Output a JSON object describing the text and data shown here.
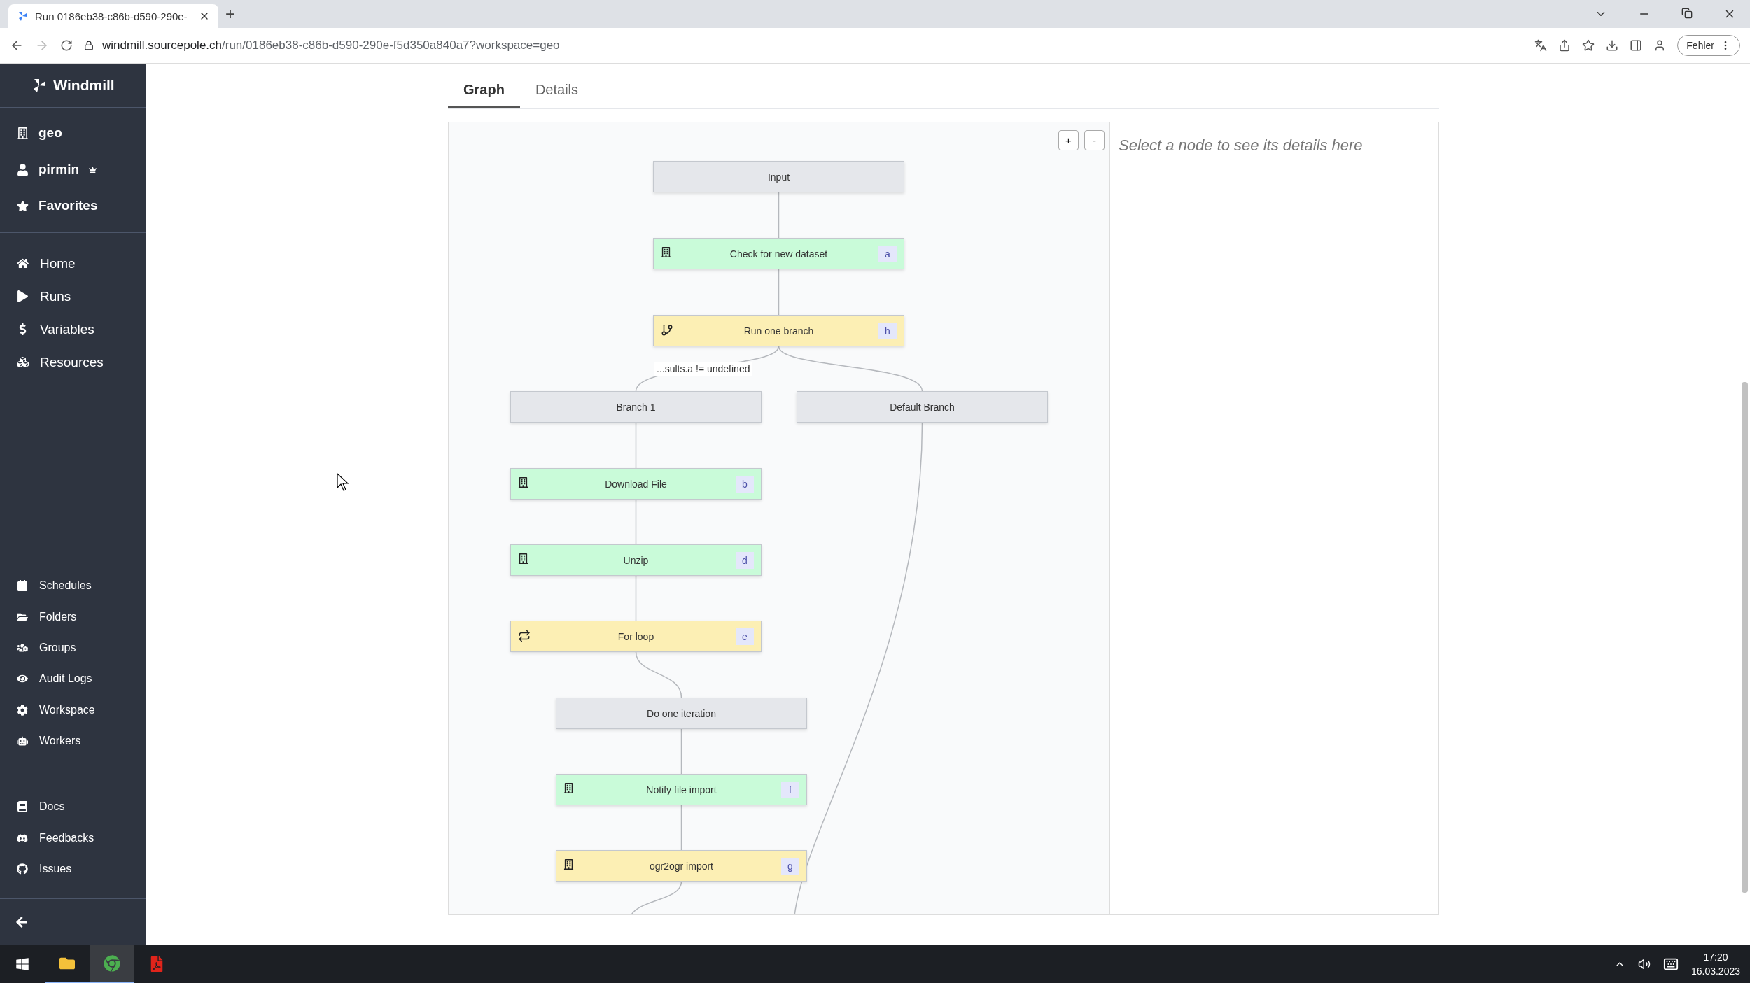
{
  "browser": {
    "tab_title": "Run 0186eb38-c86b-d590-290e-",
    "new_tab": "+",
    "url_host": "windmill.sourcepole.ch",
    "url_path": "/run/0186eb38-c86b-d590-290e-f5d350a840a7?workspace=geo",
    "profile_button": "Fehler"
  },
  "sidebar": {
    "brand": "Windmill",
    "workspace_menu": [
      {
        "label": "geo",
        "crown": false
      },
      {
        "label": "pirmin",
        "crown": true
      },
      {
        "label": "Favorites",
        "crown": false
      }
    ],
    "main_nav": [
      "Home",
      "Runs",
      "Variables",
      "Resources"
    ],
    "manage_nav": [
      "Schedules",
      "Folders",
      "Groups",
      "Audit Logs",
      "Workspace",
      "Workers"
    ],
    "help_nav": [
      "Docs",
      "Feedbacks",
      "Issues"
    ]
  },
  "tabs": [
    {
      "label": "Graph",
      "selected": true
    },
    {
      "label": "Details",
      "selected": false
    }
  ],
  "graph": {
    "zoom_in": "+",
    "zoom_out": "-",
    "edge_label": "...sults.a != undefined",
    "nodes": [
      {
        "label": "Input",
        "kind": "input",
        "color": "#e5e7eb"
      },
      {
        "label": "Check for new dataset",
        "kind": "script",
        "color": "#c9fbd9",
        "badge": "a"
      },
      {
        "label": "Run one branch",
        "kind": "branch",
        "color": "#fcefb4",
        "badge": "h"
      },
      {
        "label": "Branch 1",
        "kind": "group",
        "color": "#e5e7eb"
      },
      {
        "label": "Default Branch",
        "kind": "group",
        "color": "#e5e7eb"
      },
      {
        "label": "Download File",
        "kind": "script",
        "color": "#c9fbd9",
        "badge": "b"
      },
      {
        "label": "Unzip",
        "kind": "script",
        "color": "#c9fbd9",
        "badge": "d"
      },
      {
        "label": "For loop",
        "kind": "loop",
        "color": "#fcefb4",
        "badge": "e"
      },
      {
        "label": "Do one iteration",
        "kind": "group",
        "color": "#e5e7eb"
      },
      {
        "label": "Notify file import",
        "kind": "script",
        "color": "#c9fbd9",
        "badge": "f"
      },
      {
        "label": "ogr2ogr import",
        "kind": "script",
        "color": "#fcefb4",
        "badge": "g"
      }
    ]
  },
  "details": {
    "empty_message": "Select a node to see its details here"
  },
  "taskbar": {
    "time": "17:20",
    "date": "16.03.2023"
  }
}
